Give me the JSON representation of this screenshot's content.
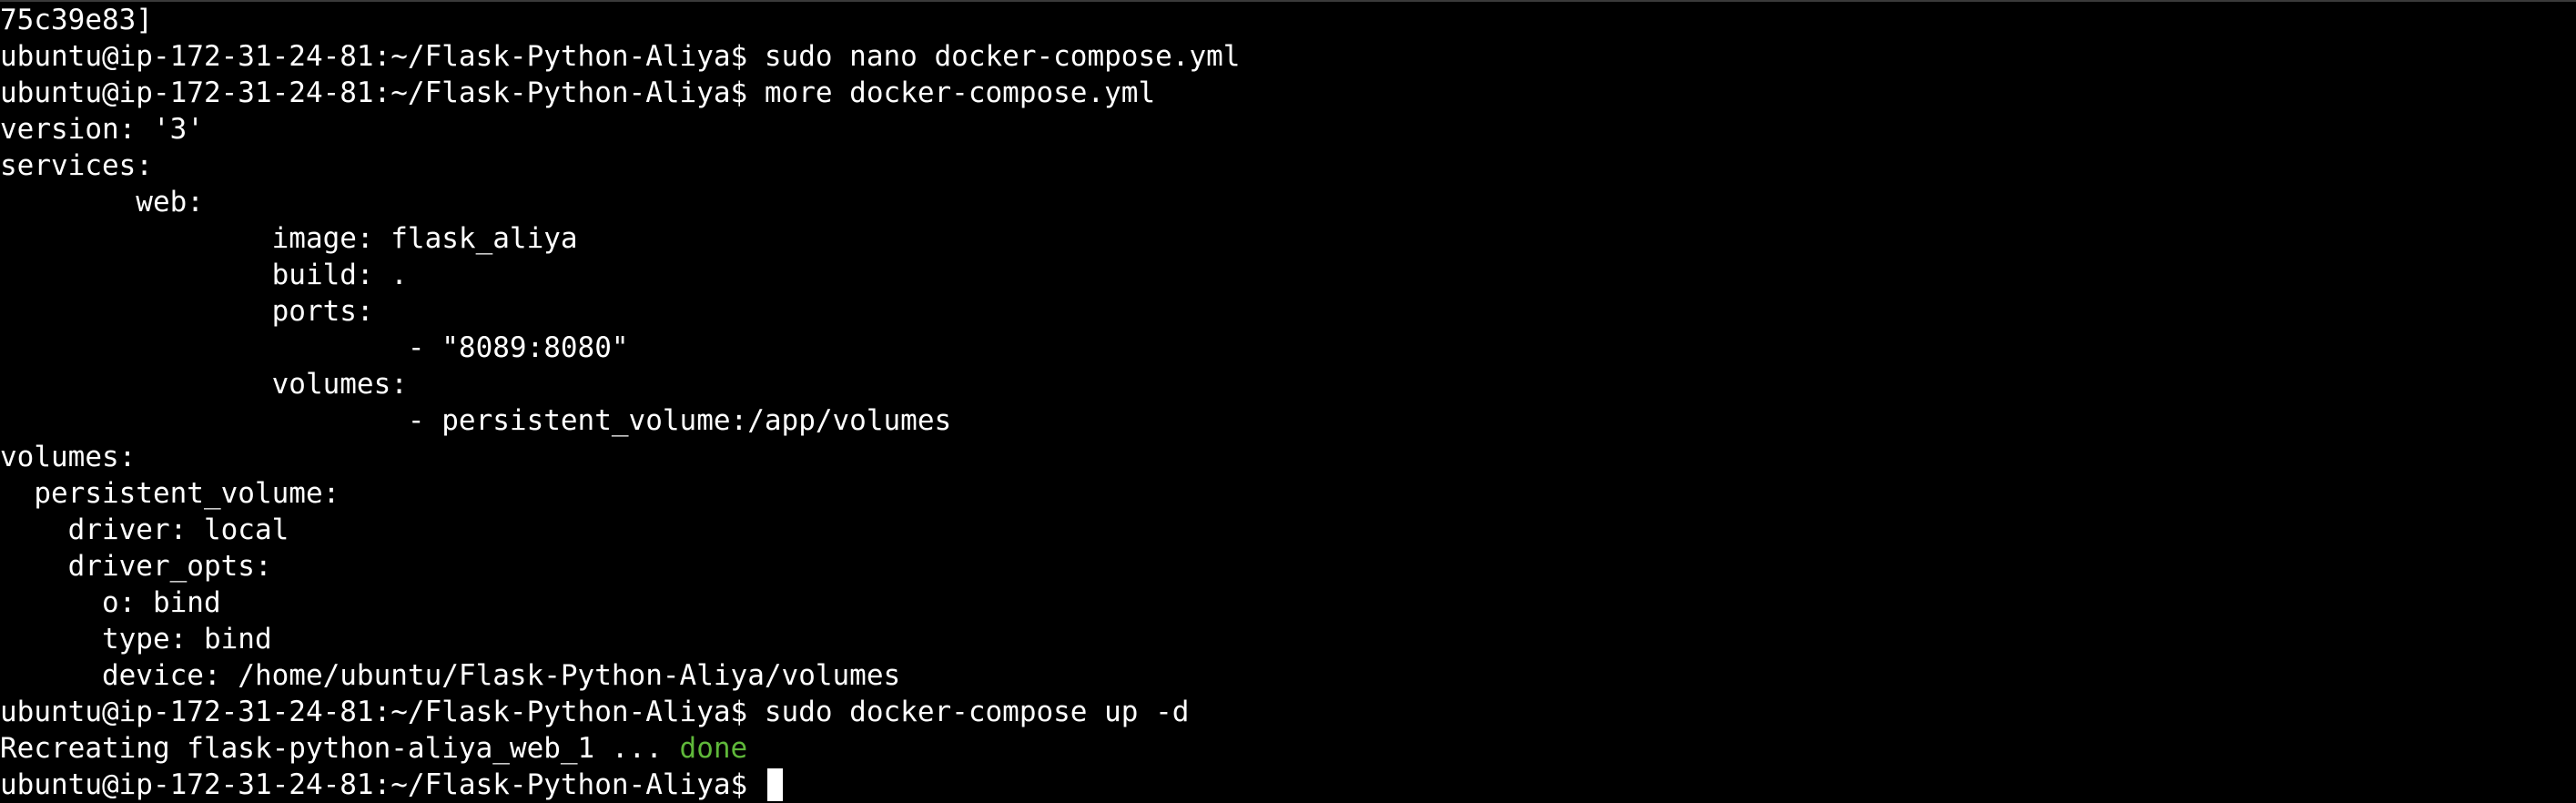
{
  "terminal": {
    "lines": [
      "75c39e83]",
      "ubuntu@ip-172-31-24-81:~/Flask-Python-Aliya$ sudo nano docker-compose.yml",
      "ubuntu@ip-172-31-24-81:~/Flask-Python-Aliya$ more docker-compose.yml",
      "version: '3'",
      "services:",
      "        web:",
      "                image: flask_aliya",
      "                build: .",
      "                ports:",
      "                        - \"8089:8080\"",
      "                volumes:",
      "                        - persistent_volume:/app/volumes",
      "volumes:",
      "  persistent_volume:",
      "    driver: local",
      "    driver_opts:",
      "      o: bind",
      "      type: bind",
      "      device: /home/ubuntu/Flask-Python-Aliya/volumes",
      "ubuntu@ip-172-31-24-81:~/Flask-Python-Aliya$ sudo docker-compose up -d"
    ],
    "status_prefix": "Recreating flask-python-aliya_web_1 ... ",
    "status_done": "done",
    "prompt": "ubuntu@ip-172-31-24-81:~/Flask-Python-Aliya$ ",
    "colors": {
      "background": "#000000",
      "foreground": "#ffffff",
      "done": "#5fb83a"
    }
  }
}
